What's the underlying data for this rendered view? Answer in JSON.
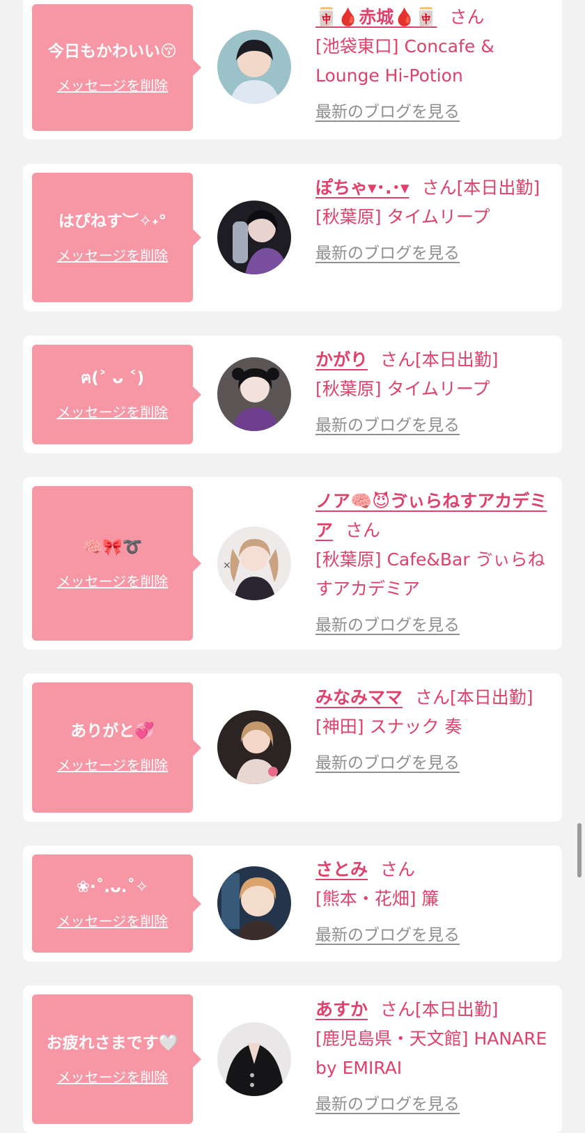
{
  "common": {
    "delete_label": "メッセージを削除",
    "blog_label": "最新のブログを見る",
    "san": "さん"
  },
  "colors": {
    "background": "#f2f2f2",
    "card": "#ffffff",
    "bubble": "#f797a5",
    "accent": "#e0416b",
    "link_gray": "#8e8e8e"
  },
  "items": [
    {
      "message": "今日もかわいい😚",
      "name": "🀄🩸赤城🩸🀄",
      "status": "",
      "shop": "[池袋東口] Concafe & Lounge Hi-Potion"
    },
    {
      "message": "はぴねす︶✧˖°",
      "name": "ぽちゃ▾･.･▾",
      "status": "[本日出勤]",
      "shop": "[秋葉原] タイムリープ"
    },
    {
      "message": "ฅ(˃ ᴗ ˂)",
      "name": "かがり",
      "status": "[本日出勤]",
      "shop": "[秋葉原] タイムリープ"
    },
    {
      "message": "🧠🎀➰",
      "name": "ノア🧠😈ゔぃらねすアカデミア",
      "status": "",
      "shop": "[秋葉原] Cafe&Bar ゔぃらねすアカデミア"
    },
    {
      "message": "ありがと💞",
      "name": "みなみママ",
      "status": "[本日出勤]",
      "shop": "[神田] スナック 奏"
    },
    {
      "message": "❀·˚.ᴗ.˚✧",
      "name": "さとみ",
      "status": "",
      "shop": "[熊本・花畑] 簾"
    },
    {
      "message": "お疲れさまです🤍",
      "name": "あすか",
      "status": "[本日出勤]",
      "shop": "[鹿児島県・天文館] HANARE by EMIRAI"
    }
  ]
}
